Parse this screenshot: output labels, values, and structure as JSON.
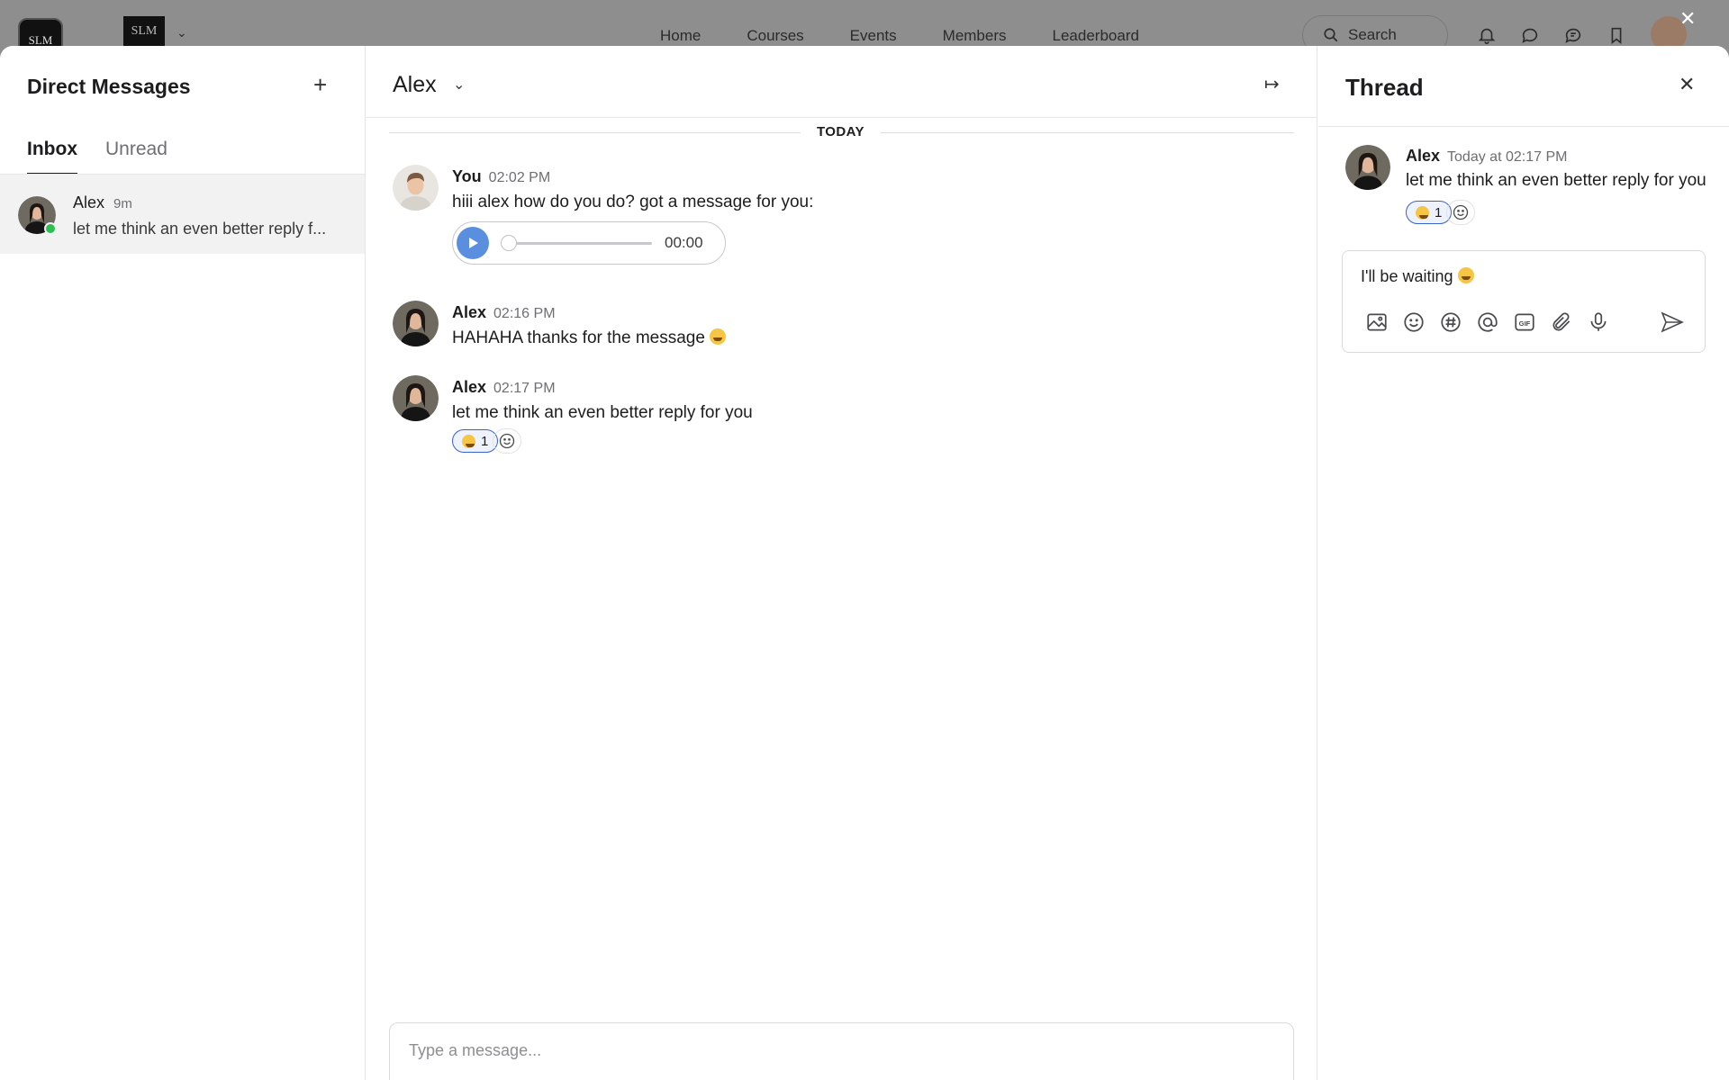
{
  "topbar": {
    "logo_text": "SLM",
    "logo_small_text": "SLM",
    "nav": [
      "Home",
      "Courses",
      "Events",
      "Members",
      "Leaderboard"
    ],
    "search_label": "Search"
  },
  "sidebar": {
    "title": "Direct Messages",
    "tabs": [
      "Inbox",
      "Unread"
    ],
    "conversations": [
      {
        "name": "Alex",
        "time": "9m",
        "preview": "let me think an even better reply f..."
      }
    ]
  },
  "chat": {
    "contact_name": "Alex",
    "day_label": "TODAY",
    "messages": [
      {
        "author": "You",
        "time": "02:02 PM",
        "text": "hiii alex how do you do? got a message for you:",
        "audio_time": "00:00"
      },
      {
        "author": "Alex",
        "time": "02:16 PM",
        "text": "HAHAHA thanks for the message"
      },
      {
        "author": "Alex",
        "time": "02:17 PM",
        "text": "let me think an even better reply for you",
        "reaction_count": "1"
      }
    ],
    "compose_placeholder": "Type a message..."
  },
  "thread": {
    "title": "Thread",
    "message": {
      "author": "Alex",
      "time": "Today at 02:17 PM",
      "text": "let me think an even better reply for you",
      "reaction_count": "1"
    },
    "reply_text": "I'll be waiting",
    "gif_label": "GIF"
  },
  "colors": {
    "accent": "#3a63c8",
    "play_button": "#5a8fe0",
    "online": "#2fbf51"
  },
  "icons": [
    "search-icon",
    "bell-icon",
    "chat-icon",
    "messages-icon",
    "bookmark-icon",
    "plus-icon",
    "chevron-down-icon",
    "collapse-panel-icon",
    "close-icon",
    "play-icon",
    "smiley-add-icon",
    "image-icon",
    "hashtag-icon",
    "mention-icon",
    "gif-icon",
    "paperclip-icon",
    "microphone-icon",
    "send-icon"
  ]
}
